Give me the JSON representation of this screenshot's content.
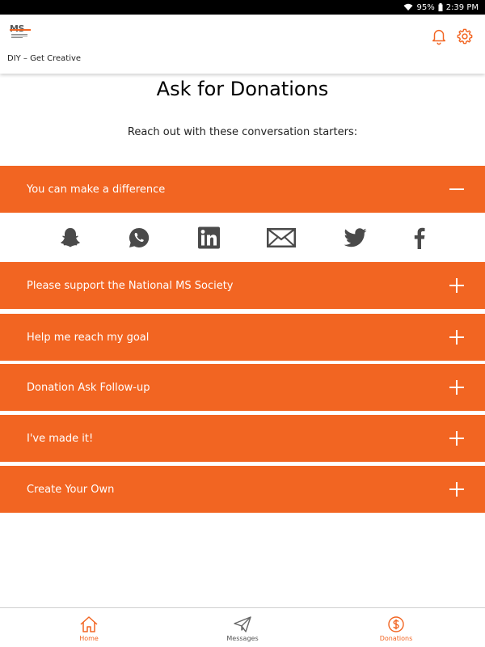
{
  "status_bar": {
    "battery": "95%",
    "time": "2:39 PM"
  },
  "app": {
    "subtitle": "DIY – Get Creative",
    "logo_text": "MS",
    "logo_icon": "ms-logo-icon"
  },
  "header_icons": [
    "bell-icon",
    "gear-icon"
  ],
  "page": {
    "title": "Ask for Donations",
    "intro": "Reach out with these conversation starters:"
  },
  "accordion": [
    {
      "label": "You can make a difference",
      "expanded": true
    },
    {
      "label": "Please support the National MS Society",
      "expanded": false
    },
    {
      "label": "Help me reach my goal",
      "expanded": false
    },
    {
      "label": "Donation Ask Follow-up",
      "expanded": false
    },
    {
      "label": "I've made it!",
      "expanded": false
    },
    {
      "label": "Create Your Own",
      "expanded": false
    }
  ],
  "share_icons": [
    "snapchat-icon",
    "whatsapp-icon",
    "linkedin-icon",
    "email-icon",
    "twitter-icon",
    "facebook-icon"
  ],
  "bottom_nav": [
    {
      "label": "Home",
      "icon": "home-icon",
      "active": true
    },
    {
      "label": "Messages",
      "icon": "paper-plane-icon",
      "active": false
    },
    {
      "label": "Donations",
      "icon": "dollar-circle-icon",
      "active": true
    }
  ],
  "colors": {
    "brand": "#f26522",
    "icon_gray": "#4a4a4a",
    "nav_gray": "#666666"
  }
}
